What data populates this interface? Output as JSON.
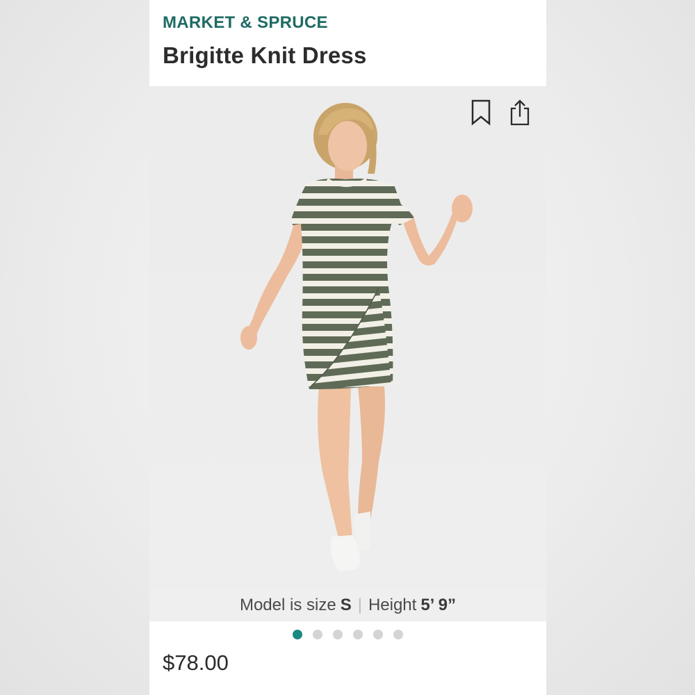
{
  "product": {
    "brand": "MARKET & SPRUCE",
    "name": "Brigitte Knit Dress",
    "price": "$78.00"
  },
  "model_info": {
    "size_label": "Model is size",
    "size_value": "S",
    "separator": "|",
    "height_label": "Height",
    "height_value": "5’ 9”"
  },
  "carousel": {
    "total": 6,
    "active_index": 0
  },
  "actions": {
    "save_icon": "bookmark-icon",
    "share_icon": "share-icon"
  },
  "colors": {
    "brand": "#1f6b64",
    "active_dot": "#1a8a80",
    "inactive_dot": "#d4d4d4",
    "stripe_dark": "#5f6b57",
    "stripe_light": "#f2f0e6"
  }
}
